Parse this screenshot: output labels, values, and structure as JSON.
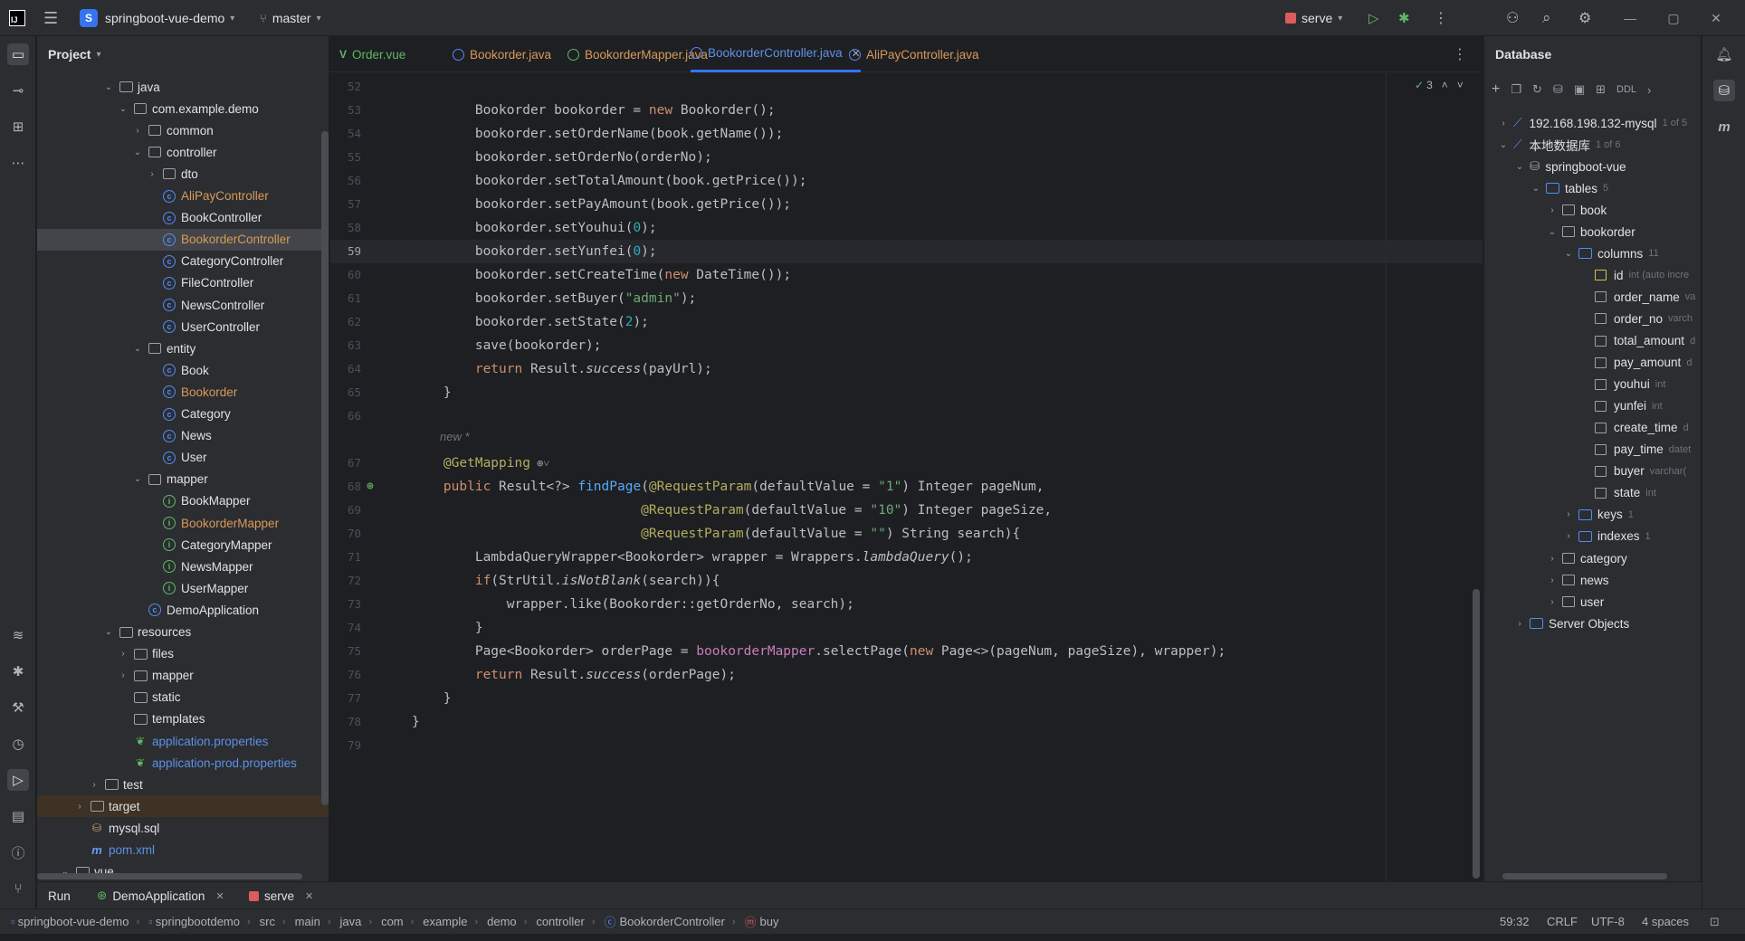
{
  "titlebar": {
    "project_badge": "S",
    "project_name": "springboot-vue-demo",
    "branch": "master",
    "run_config": "serve"
  },
  "project_panel": {
    "title": "Project",
    "tree": [
      {
        "label": "java",
        "kind": "folder",
        "depth": 3,
        "arrow": "down",
        "color": ""
      },
      {
        "label": "com.example.demo",
        "kind": "pkg",
        "depth": 4,
        "arrow": "down",
        "color": ""
      },
      {
        "label": "common",
        "kind": "pkg",
        "depth": 5,
        "arrow": "right",
        "color": ""
      },
      {
        "label": "controller",
        "kind": "pkg",
        "depth": 5,
        "arrow": "down",
        "color": ""
      },
      {
        "label": "dto",
        "kind": "pkg",
        "depth": 6,
        "arrow": "right",
        "color": ""
      },
      {
        "label": "AliPayController",
        "kind": "class",
        "depth": 6,
        "arrow": "",
        "color": "orange"
      },
      {
        "label": "BookController",
        "kind": "class",
        "depth": 6,
        "arrow": "",
        "color": ""
      },
      {
        "label": "BookorderController",
        "kind": "class",
        "depth": 6,
        "arrow": "",
        "color": "orange",
        "selected": true
      },
      {
        "label": "CategoryController",
        "kind": "class",
        "depth": 6,
        "arrow": "",
        "color": ""
      },
      {
        "label": "FileController",
        "kind": "class",
        "depth": 6,
        "arrow": "",
        "color": ""
      },
      {
        "label": "NewsController",
        "kind": "class",
        "depth": 6,
        "arrow": "",
        "color": ""
      },
      {
        "label": "UserController",
        "kind": "class",
        "depth": 6,
        "arrow": "",
        "color": ""
      },
      {
        "label": "entity",
        "kind": "pkg",
        "depth": 5,
        "arrow": "down",
        "color": ""
      },
      {
        "label": "Book",
        "kind": "class",
        "depth": 6,
        "arrow": "",
        "color": ""
      },
      {
        "label": "Bookorder",
        "kind": "class",
        "depth": 6,
        "arrow": "",
        "color": "orange"
      },
      {
        "label": "Category",
        "kind": "class",
        "depth": 6,
        "arrow": "",
        "color": ""
      },
      {
        "label": "News",
        "kind": "class",
        "depth": 6,
        "arrow": "",
        "color": ""
      },
      {
        "label": "User",
        "kind": "class",
        "depth": 6,
        "arrow": "",
        "color": ""
      },
      {
        "label": "mapper",
        "kind": "pkg",
        "depth": 5,
        "arrow": "down",
        "color": ""
      },
      {
        "label": "BookMapper",
        "kind": "iface",
        "depth": 6,
        "arrow": "",
        "color": ""
      },
      {
        "label": "BookorderMapper",
        "kind": "iface",
        "depth": 6,
        "arrow": "",
        "color": "orange"
      },
      {
        "label": "CategoryMapper",
        "kind": "iface",
        "depth": 6,
        "arrow": "",
        "color": ""
      },
      {
        "label": "NewsMapper",
        "kind": "iface",
        "depth": 6,
        "arrow": "",
        "color": ""
      },
      {
        "label": "UserMapper",
        "kind": "iface",
        "depth": 6,
        "arrow": "",
        "color": ""
      },
      {
        "label": "DemoApplication",
        "kind": "class",
        "depth": 5,
        "arrow": "",
        "color": ""
      },
      {
        "label": "resources",
        "kind": "folder",
        "depth": 3,
        "arrow": "down",
        "color": ""
      },
      {
        "label": "files",
        "kind": "folder",
        "depth": 4,
        "arrow": "right",
        "color": ""
      },
      {
        "label": "mapper",
        "kind": "folder",
        "depth": 4,
        "arrow": "right",
        "color": ""
      },
      {
        "label": "static",
        "kind": "folder",
        "depth": 4,
        "arrow": "",
        "color": ""
      },
      {
        "label": "templates",
        "kind": "folder",
        "depth": 4,
        "arrow": "",
        "color": ""
      },
      {
        "label": "application.properties",
        "kind": "leaf",
        "depth": 4,
        "arrow": "",
        "color": "blue"
      },
      {
        "label": "application-prod.properties",
        "kind": "leaf",
        "depth": 4,
        "arrow": "",
        "color": "blue"
      },
      {
        "label": "test",
        "kind": "folder",
        "depth": 2,
        "arrow": "right",
        "color": ""
      },
      {
        "label": "target",
        "kind": "folder",
        "depth": 1,
        "arrow": "right",
        "color": "",
        "excluded": true
      },
      {
        "label": "mysql.sql",
        "kind": "db",
        "depth": 1,
        "arrow": "",
        "color": ""
      },
      {
        "label": "pom.xml",
        "kind": "m",
        "depth": 1,
        "arrow": "",
        "color": "blue"
      },
      {
        "label": "vue",
        "kind": "folder",
        "depth": 0,
        "arrow": "down",
        "color": ""
      }
    ]
  },
  "tabs": [
    {
      "label": "Order.vue",
      "icon": "vue",
      "color": "#5fb865",
      "active": false
    },
    {
      "label": "Bookorder.java",
      "icon": "class",
      "color": "#d99a5a",
      "active": false
    },
    {
      "label": "BookorderMapper.java",
      "icon": "iface",
      "color": "#d99a5a",
      "active": false
    },
    {
      "label": "BookorderController.java",
      "icon": "class",
      "color": "#5d91e8",
      "active": true
    },
    {
      "label": "AliPayController.java",
      "icon": "class",
      "color": "#d99a5a",
      "active": false
    }
  ],
  "editor": {
    "inspection_count": "3",
    "usage_hint": "new *",
    "lines": [
      {
        "n": "52",
        "html": ""
      },
      {
        "n": "53",
        "html": "        Bookorder bookorder = <span class='kw'>new</span> Bookorder();"
      },
      {
        "n": "54",
        "html": "        bookorder.setOrderName(book.getName());"
      },
      {
        "n": "55",
        "html": "        bookorder.setOrderNo(orderNo);"
      },
      {
        "n": "56",
        "html": "        bookorder.setTotalAmount(book.getPrice());"
      },
      {
        "n": "57",
        "html": "        bookorder.setPayAmount(book.getPrice());"
      },
      {
        "n": "58",
        "html": "        bookorder.setYouhui(<span class='num'>0</span>);"
      },
      {
        "n": "59",
        "html": "        bookorder.setYunfei(<span class='num'>0</span>);",
        "current": true
      },
      {
        "n": "60",
        "html": "        bookorder.setCreateTime(<span class='kw'>new</span> DateTime());"
      },
      {
        "n": "61",
        "html": "        bookorder.setBuyer(<span class='str'>\"admin\"</span>);"
      },
      {
        "n": "62",
        "html": "        bookorder.setState(<span class='num'>2</span>);"
      },
      {
        "n": "63",
        "html": "        save(bookorder);"
      },
      {
        "n": "64",
        "html": "        <span class='kw'>return</span> Result.<span class='it'>success</span>(payUrl);"
      },
      {
        "n": "65",
        "html": "    }"
      },
      {
        "n": "66",
        "html": ""
      },
      {
        "n": "67",
        "html": "    <span class='ann'>@GetMapping</span>"
      },
      {
        "n": "68",
        "html": "    <span class='kw'>public</span> Result&lt;?&gt; <span class='fn'>findPage</span>(<span class='ann'>@RequestParam</span>(defaultValue = <span class='str'>\"1\"</span>) Integer pageNum,"
      },
      {
        "n": "69",
        "html": "                             <span class='ann'>@RequestParam</span>(defaultValue = <span class='str'>\"10\"</span>) Integer pageSize,"
      },
      {
        "n": "70",
        "html": "                             <span class='ann'>@RequestParam</span>(defaultValue = <span class='str'>\"\"</span>) String search){"
      },
      {
        "n": "71",
        "html": "        LambdaQueryWrapper&lt;Bookorder&gt; wrapper = Wrappers.<span class='it'>lambdaQuery</span>();"
      },
      {
        "n": "72",
        "html": "        <span class='kw'>if</span>(StrUtil.<span class='it'>isNotBlank</span>(search)){"
      },
      {
        "n": "73",
        "html": "            wrapper.like(Bookorder::getOrderNo, search);"
      },
      {
        "n": "74",
        "html": "        }"
      },
      {
        "n": "75",
        "html": "        Page&lt;Bookorder&gt; orderPage = <span class='mem'>bookorderMapper</span>.selectPage(<span class='kw'>new</span> Page&lt;&gt;(pageNum, pageSize), wrapper);"
      },
      {
        "n": "76",
        "html": "        <span class='kw'>return</span> Result.<span class='it'>success</span>(orderPage);"
      },
      {
        "n": "77",
        "html": "    }"
      },
      {
        "n": "78",
        "html": "}"
      },
      {
        "n": "79",
        "html": ""
      }
    ]
  },
  "database": {
    "title": "Database",
    "ddl_label": "DDL",
    "tree": [
      {
        "label": "192.168.198.132-mysql",
        "sub": "1 of 5",
        "depth": 0,
        "arrow": "right",
        "kind": "conn"
      },
      {
        "label": "本地数据库",
        "sub": "1 of 6",
        "depth": 0,
        "arrow": "down",
        "kind": "conn"
      },
      {
        "label": "springboot-vue",
        "sub": "",
        "depth": 1,
        "arrow": "down",
        "kind": "schema"
      },
      {
        "label": "tables",
        "sub": "5",
        "depth": 2,
        "arrow": "down",
        "kind": "fold"
      },
      {
        "label": "book",
        "sub": "",
        "depth": 3,
        "arrow": "right",
        "kind": "table"
      },
      {
        "label": "bookorder",
        "sub": "",
        "depth": 3,
        "arrow": "down",
        "kind": "table"
      },
      {
        "label": "columns",
        "sub": "11",
        "depth": 4,
        "arrow": "down",
        "kind": "fold"
      },
      {
        "label": "id",
        "sub": "int (auto incre",
        "depth": 5,
        "arrow": "",
        "kind": "pk"
      },
      {
        "label": "order_name",
        "sub": "va",
        "depth": 5,
        "arrow": "",
        "kind": "col"
      },
      {
        "label": "order_no",
        "sub": "varch",
        "depth": 5,
        "arrow": "",
        "kind": "col"
      },
      {
        "label": "total_amount",
        "sub": "d",
        "depth": 5,
        "arrow": "",
        "kind": "col"
      },
      {
        "label": "pay_amount",
        "sub": "d",
        "depth": 5,
        "arrow": "",
        "kind": "col"
      },
      {
        "label": "youhui",
        "sub": "int",
        "depth": 5,
        "arrow": "",
        "kind": "col"
      },
      {
        "label": "yunfei",
        "sub": "int",
        "depth": 5,
        "arrow": "",
        "kind": "col"
      },
      {
        "label": "create_time",
        "sub": "d",
        "depth": 5,
        "arrow": "",
        "kind": "col"
      },
      {
        "label": "pay_time",
        "sub": "datet",
        "depth": 5,
        "arrow": "",
        "kind": "col"
      },
      {
        "label": "buyer",
        "sub": "varchar(",
        "depth": 5,
        "arrow": "",
        "kind": "col"
      },
      {
        "label": "state",
        "sub": "int",
        "depth": 5,
        "arrow": "",
        "kind": "col"
      },
      {
        "label": "keys",
        "sub": "1",
        "depth": 4,
        "arrow": "right",
        "kind": "fold"
      },
      {
        "label": "indexes",
        "sub": "1",
        "depth": 4,
        "arrow": "right",
        "kind": "fold"
      },
      {
        "label": "category",
        "sub": "",
        "depth": 3,
        "arrow": "right",
        "kind": "table"
      },
      {
        "label": "news",
        "sub": "",
        "depth": 3,
        "arrow": "right",
        "kind": "table"
      },
      {
        "label": "user",
        "sub": "",
        "depth": 3,
        "arrow": "right",
        "kind": "table"
      },
      {
        "label": "Server Objects",
        "sub": "",
        "depth": 1,
        "arrow": "right",
        "kind": "fold"
      }
    ]
  },
  "bottom_tabs": {
    "run": "Run",
    "demo_app": "DemoApplication",
    "serve": "serve"
  },
  "statusbar": {
    "crumbs": [
      "springboot-vue-demo",
      "springbootdemo",
      "src",
      "main",
      "java",
      "com",
      "example",
      "demo",
      "controller",
      "BookorderController",
      "buy"
    ],
    "position": "59:32",
    "line_sep": "CRLF",
    "encoding": "UTF-8",
    "indent": "4 spaces"
  }
}
